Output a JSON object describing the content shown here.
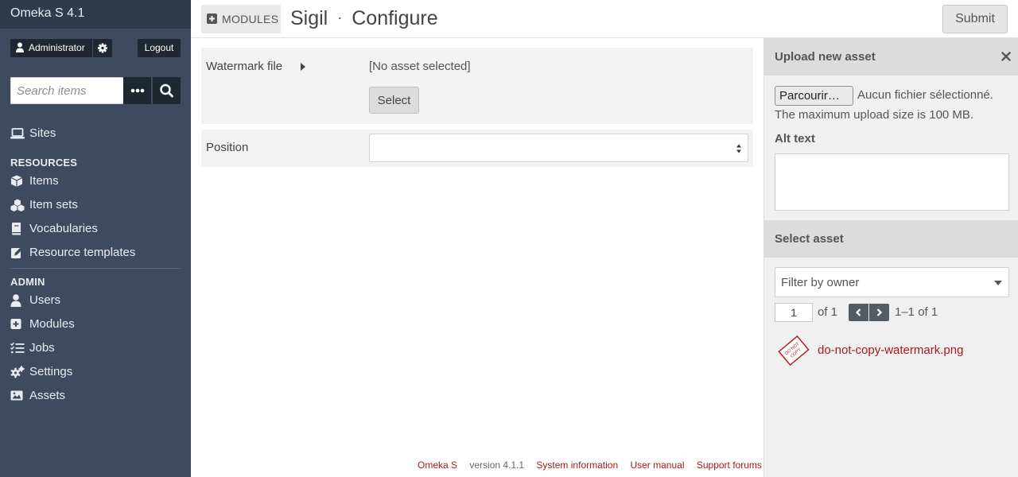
{
  "app": {
    "title": "Omeka S 4.1"
  },
  "user": {
    "name": "Administrator",
    "logout_label": "Logout"
  },
  "search": {
    "placeholder": "Search items"
  },
  "nav": {
    "sites_label": "Sites",
    "resources_heading": "RESOURCES",
    "resources": [
      "Items",
      "Item sets",
      "Vocabularies",
      "Resource templates"
    ],
    "admin_heading": "ADMIN",
    "admin": [
      "Users",
      "Modules",
      "Jobs",
      "Settings",
      "Assets"
    ]
  },
  "header": {
    "crumb_label": "MODULES",
    "title": "Sigil",
    "separator": "·",
    "subtitle": "Configure",
    "submit_label": "Submit"
  },
  "form": {
    "watermark_label": "Watermark file",
    "no_asset_text": "[No asset selected]",
    "select_label": "Select",
    "position_label": "Position",
    "position_value": ""
  },
  "footer": {
    "omeka_link": "Omeka S",
    "version": "version 4.1.1",
    "system_info": "System information",
    "user_manual": "User manual",
    "support_forums": "Support forums"
  },
  "asset_panel": {
    "upload_heading": "Upload new asset",
    "browse_label": "Parcourir…",
    "no_file_text": "Aucun fichier sélectionné.",
    "max_size_text": "The maximum upload size is 100 MB.",
    "alt_text_label": "Alt text",
    "select_heading": "Select asset",
    "owner_filter": "Filter by owner",
    "page_value": "1",
    "of_pages": "of 1",
    "range_text": "1–1 of 1",
    "asset_name": "do-not-copy-watermark.png",
    "thumb_text": [
      "DO NOT",
      "COPY"
    ]
  },
  "colors": {
    "sidebar": "#3e4b5e",
    "sidebar_dark": "#1f2733",
    "link": "#a91919"
  }
}
